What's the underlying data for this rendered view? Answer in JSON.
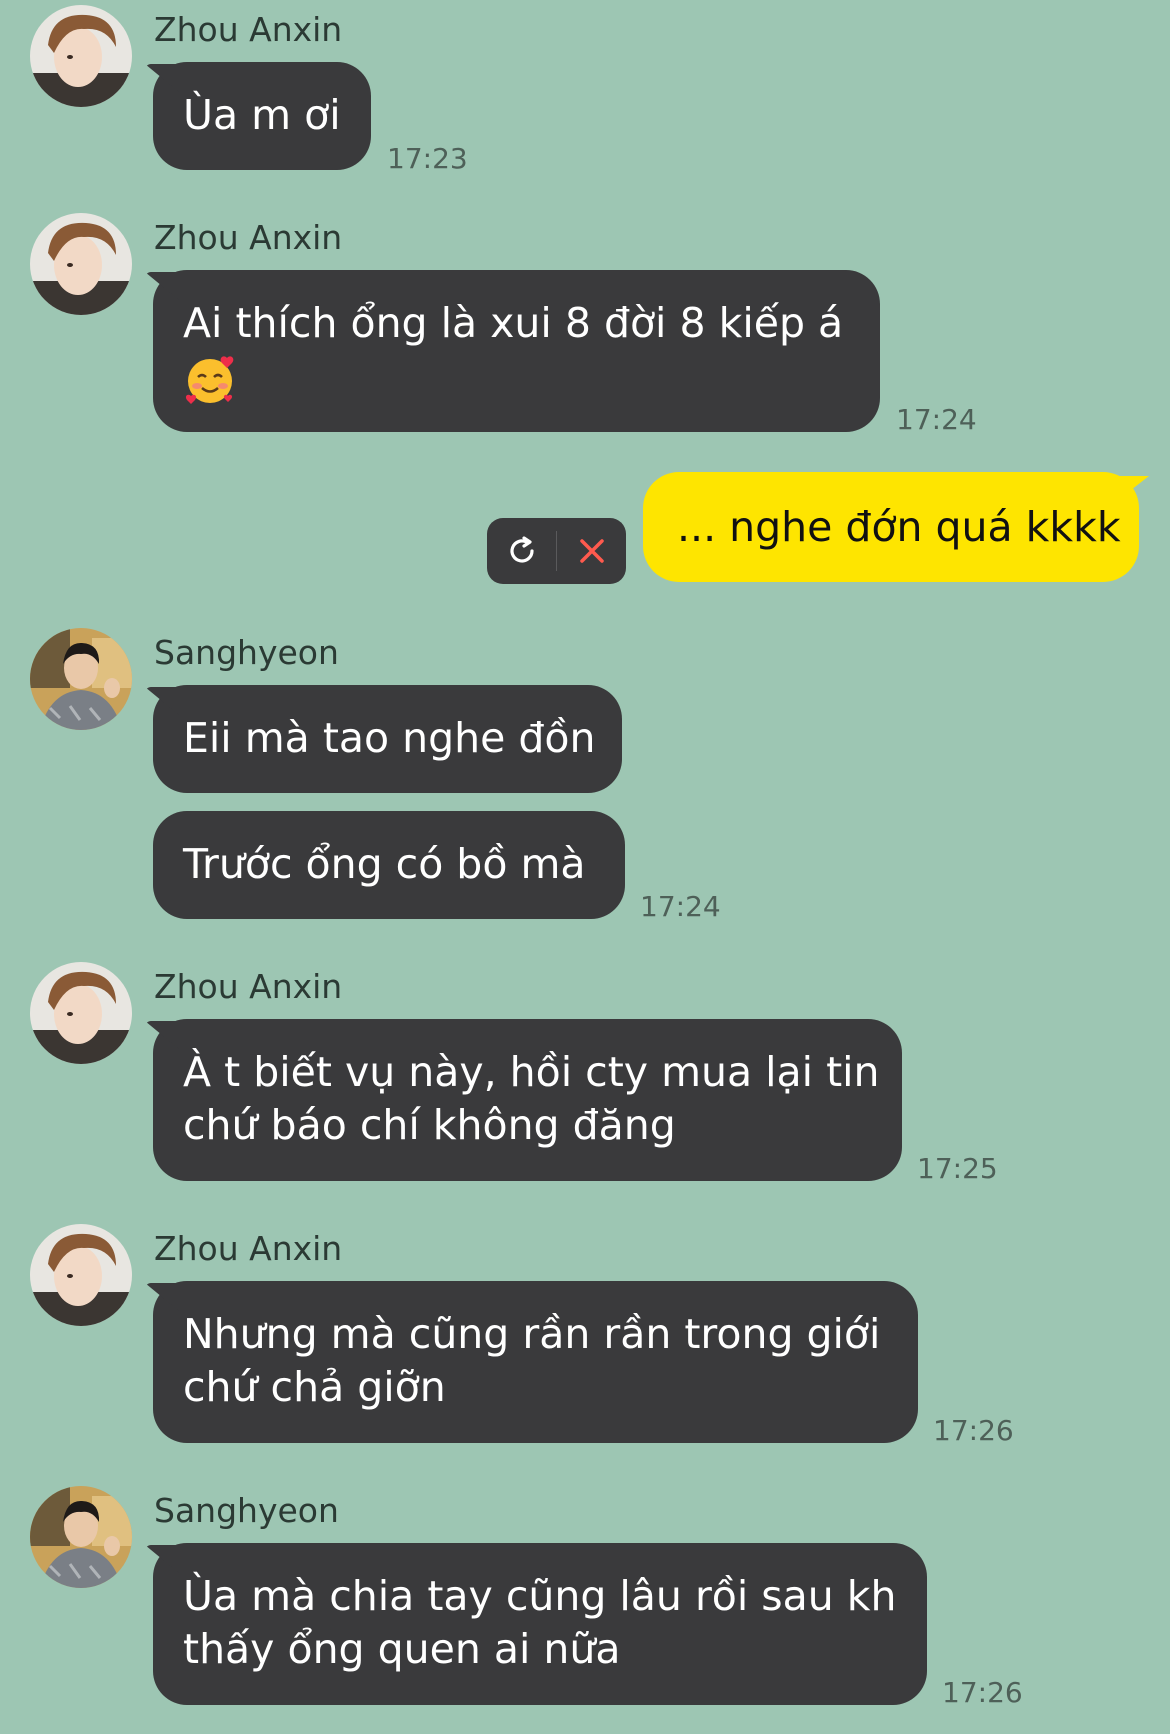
{
  "messages": [
    {
      "sender": "Zhou Anxin",
      "lines": [
        "Ùa m ơi"
      ],
      "time": "17:23"
    },
    {
      "sender": "Zhou Anxin",
      "lines": [
        "Ai thích ổng là xui 8 đời 8 kiếp á"
      ],
      "emoji": "smiling-face-with-hearts",
      "time": "17:24"
    },
    {
      "outgoing": true,
      "text": "... nghe đớn quá kkkk",
      "status": "failed",
      "actions": [
        "retry-icon",
        "delete-icon"
      ]
    },
    {
      "sender": "Sanghyeon",
      "lines": [
        "Eii mà tao nghe đồn"
      ]
    },
    {
      "lines": [
        "Trước ổng có bồ mà"
      ],
      "time": "17:24"
    },
    {
      "sender": "Zhou Anxin",
      "lines": [
        "À t biết vụ này, hồi cty mua lại tin",
        "chứ báo chí không đăng"
      ],
      "time": "17:25"
    },
    {
      "sender": "Zhou Anxin",
      "lines": [
        "Nhưng mà cũng rần rần trong giới",
        "chứ chả giỡn"
      ],
      "time": "17:26"
    },
    {
      "sender": "Sanghyeon",
      "lines": [
        "Ùa mà chia tay cũng lâu rồi sau kh",
        "thấy ổng quen ai nữa"
      ],
      "time": "17:26"
    }
  ],
  "colors": {
    "background": "#9dc6b3",
    "incoming_bubble": "#3a3a3c",
    "outgoing_bubble": "#fee500",
    "delete_icon": "#ff5a4e"
  }
}
